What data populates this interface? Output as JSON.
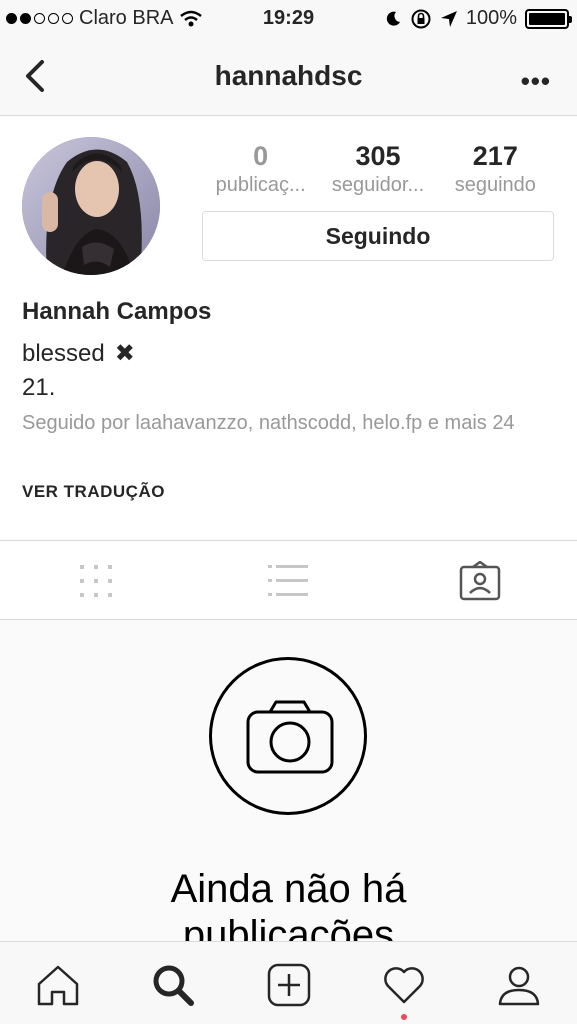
{
  "status_bar": {
    "carrier": "Claro BRA",
    "time": "19:29",
    "battery": "100%"
  },
  "header": {
    "username": "hannahdsc",
    "more_label": "•••"
  },
  "profile": {
    "stats": [
      {
        "count": "0",
        "label": "publicaç..."
      },
      {
        "count": "305",
        "label": "seguidor..."
      },
      {
        "count": "217",
        "label": "seguindo"
      }
    ],
    "follow_button": "Seguindo",
    "full_name": "Hannah Campos",
    "bio_line1": "blessed",
    "bio_line1_emoji": "✖",
    "bio_line2": "21.",
    "followed_by": "Seguido por laahavanzzo, nathscodd, helo.fp e mais 24",
    "translate": "VER TRADUÇÃO"
  },
  "empty_state": {
    "line1": "Ainda não há",
    "line2": "publicações"
  },
  "colors": {
    "muted": "#999999",
    "border": "#dbdbdb",
    "notification": "#ed4956"
  }
}
